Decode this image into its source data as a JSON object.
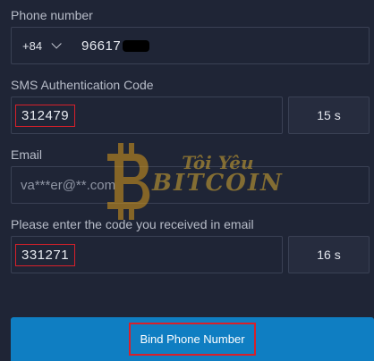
{
  "phone": {
    "label": "Phone number",
    "country_code": "+84",
    "value": "96617"
  },
  "sms": {
    "label": "SMS Authentication Code",
    "value": "312479",
    "countdown": "15 s"
  },
  "email": {
    "label": "Email",
    "value": "va***er@**.com"
  },
  "email_code": {
    "label": "Please enter the code you received in email",
    "value": "331271",
    "countdown": "16 s"
  },
  "button": {
    "label": "Bind Phone Number"
  },
  "watermark": {
    "line1": "Tôi Yêu",
    "line2": "BITCOIN"
  },
  "colors": {
    "background": "#1f2536",
    "button": "#0f7ec2",
    "highlight": "#d8202a"
  }
}
